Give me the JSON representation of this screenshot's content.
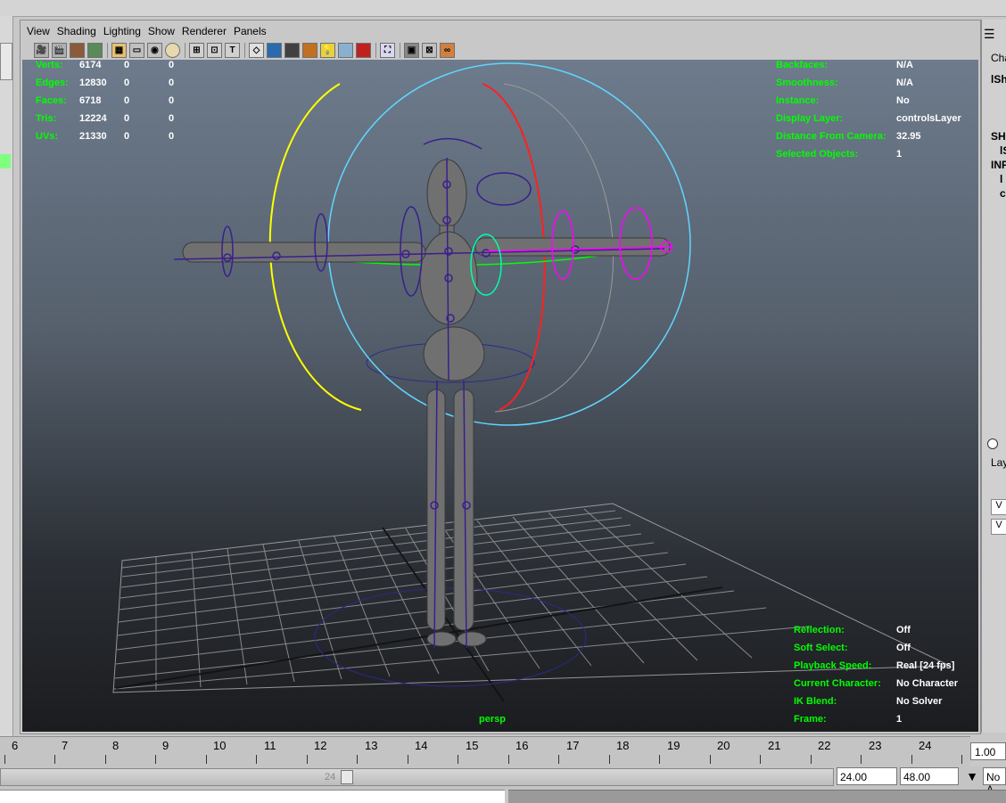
{
  "menu": {
    "items": [
      "View",
      "Shading",
      "Lighting",
      "Show",
      "Renderer",
      "Panels"
    ]
  },
  "toolbar": {
    "icons": [
      "camera-icon",
      "camera-attributes-icon",
      "bookmark-icon",
      "image-plane-icon",
      "grid-icon",
      "film-gate-icon",
      "resolution-gate-icon",
      "safe-area-icon",
      "wireframe-icon",
      "smooth-shade-icon",
      "flat-shade-icon",
      "default-lighting-icon",
      "textured-icon",
      "light-bulb-icon",
      "shadows-icon",
      "xray-icon",
      "isolate-select-icon",
      "joint-xray-icon",
      "bounding-box-icon",
      "hud-icon"
    ]
  },
  "hud": {
    "poly_stats": [
      {
        "label": "Verts:",
        "v1": "6174",
        "v2": "0",
        "v3": "0"
      },
      {
        "label": "Edges:",
        "v1": "12830",
        "v2": "0",
        "v3": "0"
      },
      {
        "label": "Faces:",
        "v1": "6718",
        "v2": "0",
        "v3": "0"
      },
      {
        "label": "Tris:",
        "v1": "12224",
        "v2": "0",
        "v3": "0"
      },
      {
        "label": "UVs:",
        "v1": "21330",
        "v2": "0",
        "v3": "0"
      }
    ],
    "object_details": [
      {
        "label": "Backfaces:",
        "value": "N/A"
      },
      {
        "label": "Smoothness:",
        "value": "N/A"
      },
      {
        "label": "Instance:",
        "value": "No"
      },
      {
        "label": "Display Layer:",
        "value": "controlsLayer"
      },
      {
        "label": "Distance From Camera:",
        "value": "32.95"
      },
      {
        "label": "Selected Objects:",
        "value": "1"
      }
    ],
    "anim_details": [
      {
        "label": "Reflection:",
        "value": "Off"
      },
      {
        "label": "Soft Select:",
        "value": "Off"
      },
      {
        "label": "Playback Speed:",
        "value": "Real [24 fps]"
      },
      {
        "label": "Current Character:",
        "value": "No Character"
      },
      {
        "label": "IK Blend:",
        "value": "No Solver"
      },
      {
        "label": "Frame:",
        "value": "1"
      }
    ],
    "camera_name": "persp"
  },
  "right_dock": {
    "labels": [
      "Cha",
      "lSh",
      "SH",
      "lS",
      "INF",
      "l",
      "c",
      "Lay",
      "V",
      "V"
    ]
  },
  "timeline": {
    "ticks": [
      "6",
      "7",
      "8",
      "9",
      "10",
      "11",
      "12",
      "13",
      "14",
      "15",
      "16",
      "17",
      "18",
      "19",
      "20",
      "21",
      "22",
      "23",
      "24"
    ],
    "current_frame": "1.00"
  },
  "range": {
    "handle_value": "24",
    "end_time": "24.00",
    "max_time": "48.00",
    "anim_layer": "No A"
  },
  "colors": {
    "hud_label": "#00ff00",
    "hud_value": "#ffffff",
    "rig_purple": "#3a1f8c",
    "rig_magenta": "#ff00ff",
    "ring_cyan": "#5fd6ff",
    "ring_yellow": "#ffff00",
    "ring_red": "#ff0000",
    "ring_green": "#00ff00"
  }
}
